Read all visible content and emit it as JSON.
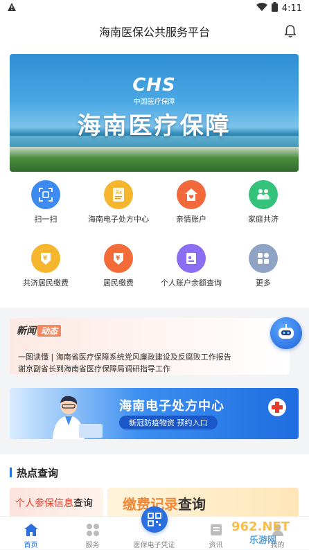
{
  "status": {
    "time": "4:11"
  },
  "header": {
    "title": "海南医保公共服务平台"
  },
  "banner": {
    "logo": "CHS",
    "logo_sub": "中国医疗保障",
    "title": "海南医疗保障"
  },
  "services": [
    {
      "label": "扫一扫",
      "icon": "scan-icon",
      "color": "#3d8af0"
    },
    {
      "label": "海南电子处方中心",
      "icon": "prescription-icon",
      "color": "#f6b52e"
    },
    {
      "label": "亲情账户",
      "icon": "home-heart-icon",
      "color": "#f26a3b"
    },
    {
      "label": "家庭共济",
      "icon": "family-icon",
      "color": "#35c27a"
    },
    {
      "label": "共济居民缴费",
      "icon": "payment-icon",
      "color": "#f5b52d"
    },
    {
      "label": "居民缴费",
      "icon": "payment-icon",
      "color": "#f36b38"
    },
    {
      "label": "个人账户余额查询",
      "icon": "balance-icon",
      "color": "#8b6ff2"
    },
    {
      "label": "更多",
      "icon": "more-icon",
      "color": "#8fa3c4"
    }
  ],
  "news": {
    "tag": "新闻",
    "tag_highlight": "动态",
    "items": [
      "一图读懂 | 海南省医疗保障系统党风廉政建设及反腐败工作报告",
      "谢京副省长到海南省医疗保障局调研指导工作"
    ]
  },
  "promo": {
    "title": "海南电子处方中心",
    "subtitle": "新冠防疫物资 预约入口"
  },
  "hot": {
    "title": "热点查询",
    "card1_red": "个人参保信息",
    "card1_black": "查询",
    "card2_orange": "缴费记录",
    "card2_black": "查询"
  },
  "tabs": [
    {
      "label": "首页",
      "icon": "home-icon"
    },
    {
      "label": "服务",
      "icon": "grid-icon"
    },
    {
      "label": "医保电子凭证",
      "icon": "qr-icon"
    },
    {
      "label": "资讯",
      "icon": "news-icon"
    },
    {
      "label": "我的",
      "icon": "user-icon"
    }
  ],
  "watermark": "962.NET 乐游网"
}
